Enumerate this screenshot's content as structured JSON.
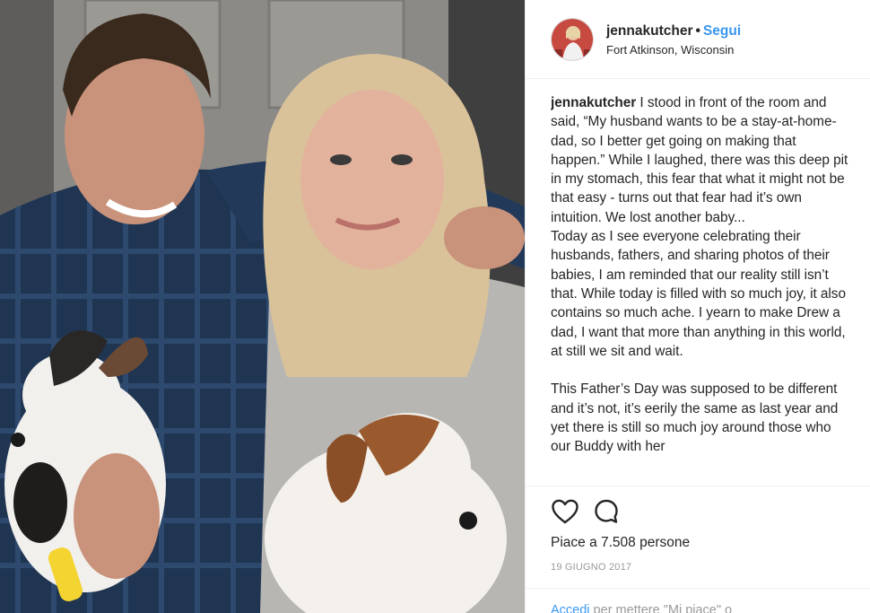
{
  "post": {
    "username": "jennakutcher",
    "separator": "•",
    "follow_label": "Segui",
    "location": "Fort Atkinson, Wisconsin"
  },
  "caption": {
    "username": "jennakutcher",
    "text": " I stood in front of the room and said, “My husband wants to be a stay-at-home-dad, so I better get going on making that happen.” While I laughed, there was this deep pit in my stomach, this fear that what it might not be that easy - turns out that fear had it’s own intuition. We lost another baby...\nToday as I see everyone celebrating their husbands, fathers, and sharing photos of their babies, I am reminded that our reality still isn’t that. While today is filled with so much joy, it also contains so much ache. I yearn to make Drew a dad, I want that more than anything in this world, at still we sit and wait.\n\nThis Father’s Day was supposed to be different and it’s not, it’s eerily the same as last year and yet there is still so much joy around those who our Buddy with her"
  },
  "actions": {
    "like_icon": "heart-icon",
    "comment_icon": "comment-icon"
  },
  "likes_text": "Piace a 7.508 persone",
  "date": "19 GIUGNO 2017",
  "login": {
    "link_label": "Accedi",
    "rest": " per mettere \"Mi piace\" o"
  }
}
